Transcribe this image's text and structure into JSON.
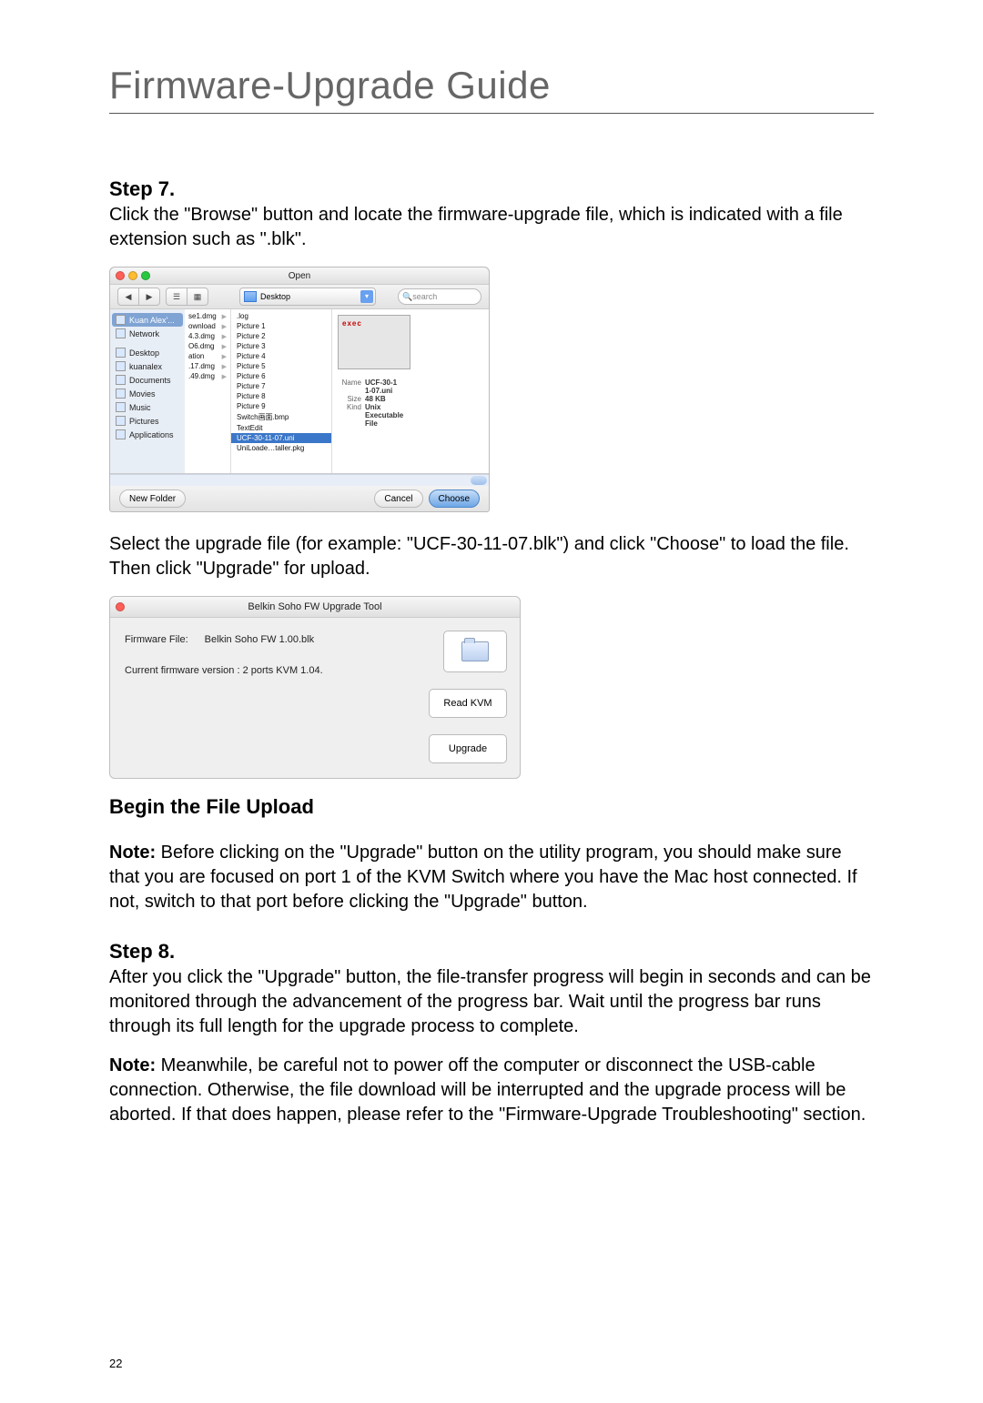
{
  "page_title": "Firmware-Upgrade Guide",
  "page_number": "22",
  "step7": {
    "heading": "Step 7.",
    "para1": "Click the \"Browse\" button and locate the firmware-upgrade file, which is indicated with a file extension such as \".blk\".",
    "para2": "Select the upgrade file (for example: \"UCF-30-11-07.blk\") and click \"Choose\" to load the file. Then click \"Upgrade\" for upload."
  },
  "open_dialog": {
    "title": "Open",
    "nav_back": "◀",
    "nav_fwd": "▶",
    "view_a": "☰",
    "view_b": "▦",
    "location_label": "Desktop",
    "popup_glyph": "▾",
    "search_placeholder": "search",
    "sidebar": [
      {
        "label": "Kuan Alex'...",
        "sel": true,
        "kind": "disk"
      },
      {
        "label": "Network",
        "kind": "network"
      },
      {
        "label": "Desktop",
        "kind": "place"
      },
      {
        "label": "kuanalex",
        "kind": "home"
      },
      {
        "label": "Documents",
        "kind": "docs"
      },
      {
        "label": "Movies",
        "kind": "movies"
      },
      {
        "label": "Music",
        "kind": "music"
      },
      {
        "label": "Pictures",
        "kind": "pictures"
      },
      {
        "label": "Applications",
        "kind": "apps"
      }
    ],
    "col1": [
      "se1.dmg",
      "ownload",
      "4.3.dmg",
      "O6.dmg",
      "ation",
      ".17.dmg",
      ".49.dmg"
    ],
    "col2": [
      {
        "label": ".log"
      },
      {
        "label": "Picture 1"
      },
      {
        "label": "Picture 2"
      },
      {
        "label": "Picture 3"
      },
      {
        "label": "Picture 4"
      },
      {
        "label": "Picture 5"
      },
      {
        "label": "Picture 6"
      },
      {
        "label": "Picture 7"
      },
      {
        "label": "Picture 8"
      },
      {
        "label": "Picture 9"
      },
      {
        "label": "Switch画面.bmp"
      },
      {
        "label": "TextEdit"
      },
      {
        "label": "UCF-30-11-07.uni",
        "sel": true
      },
      {
        "label": "UniLoade…taller.pkg"
      }
    ],
    "preview_tag": "exec",
    "info_name_k": "Name",
    "info_name_v1": "UCF-30-1",
    "info_name_v2": "1-07.uni",
    "info_size_k": "Size",
    "info_size_v": "48 KB",
    "info_kind_k": "Kind",
    "info_kind_v1": "Unix",
    "info_kind_v2": "Executable",
    "info_kind_v3": "File",
    "btn_newfolder": "New Folder",
    "btn_cancel": "Cancel",
    "btn_choose": "Choose"
  },
  "fw_tool": {
    "title": "Belkin Soho FW Upgrade Tool",
    "firmware_file_k": "Firmware File:",
    "firmware_file_v": "Belkin Soho FW 1.00.blk",
    "version_line": "Current firmware version : 2 ports KVM 1.04.",
    "btn_read": "Read KVM",
    "btn_upgrade": "Upgrade"
  },
  "begin_upload": {
    "heading": "Begin the File Upload",
    "note_label": "Note:",
    "note_rest": " Before clicking on the \"Upgrade\" button on the utility program, you should make sure that you are focused on port 1 of the KVM Switch where you have the Mac host connected. If not, switch to that port before clicking the \"Upgrade\" button."
  },
  "step8": {
    "heading": "Step 8.",
    "para": "After you click the \"Upgrade\" button, the file-transfer progress will begin in seconds and can be monitored through the advancement of the progress bar. Wait until the progress bar runs through its full length for the upgrade process to complete.",
    "note_label": "Note:",
    "note_rest": " Meanwhile, be careful not to power off the computer or disconnect the USB-cable connection. Otherwise, the file download will be interrupted and the upgrade process will be aborted. If that does happen, please refer to the \"Firmware-Upgrade Troubleshooting\" section."
  }
}
